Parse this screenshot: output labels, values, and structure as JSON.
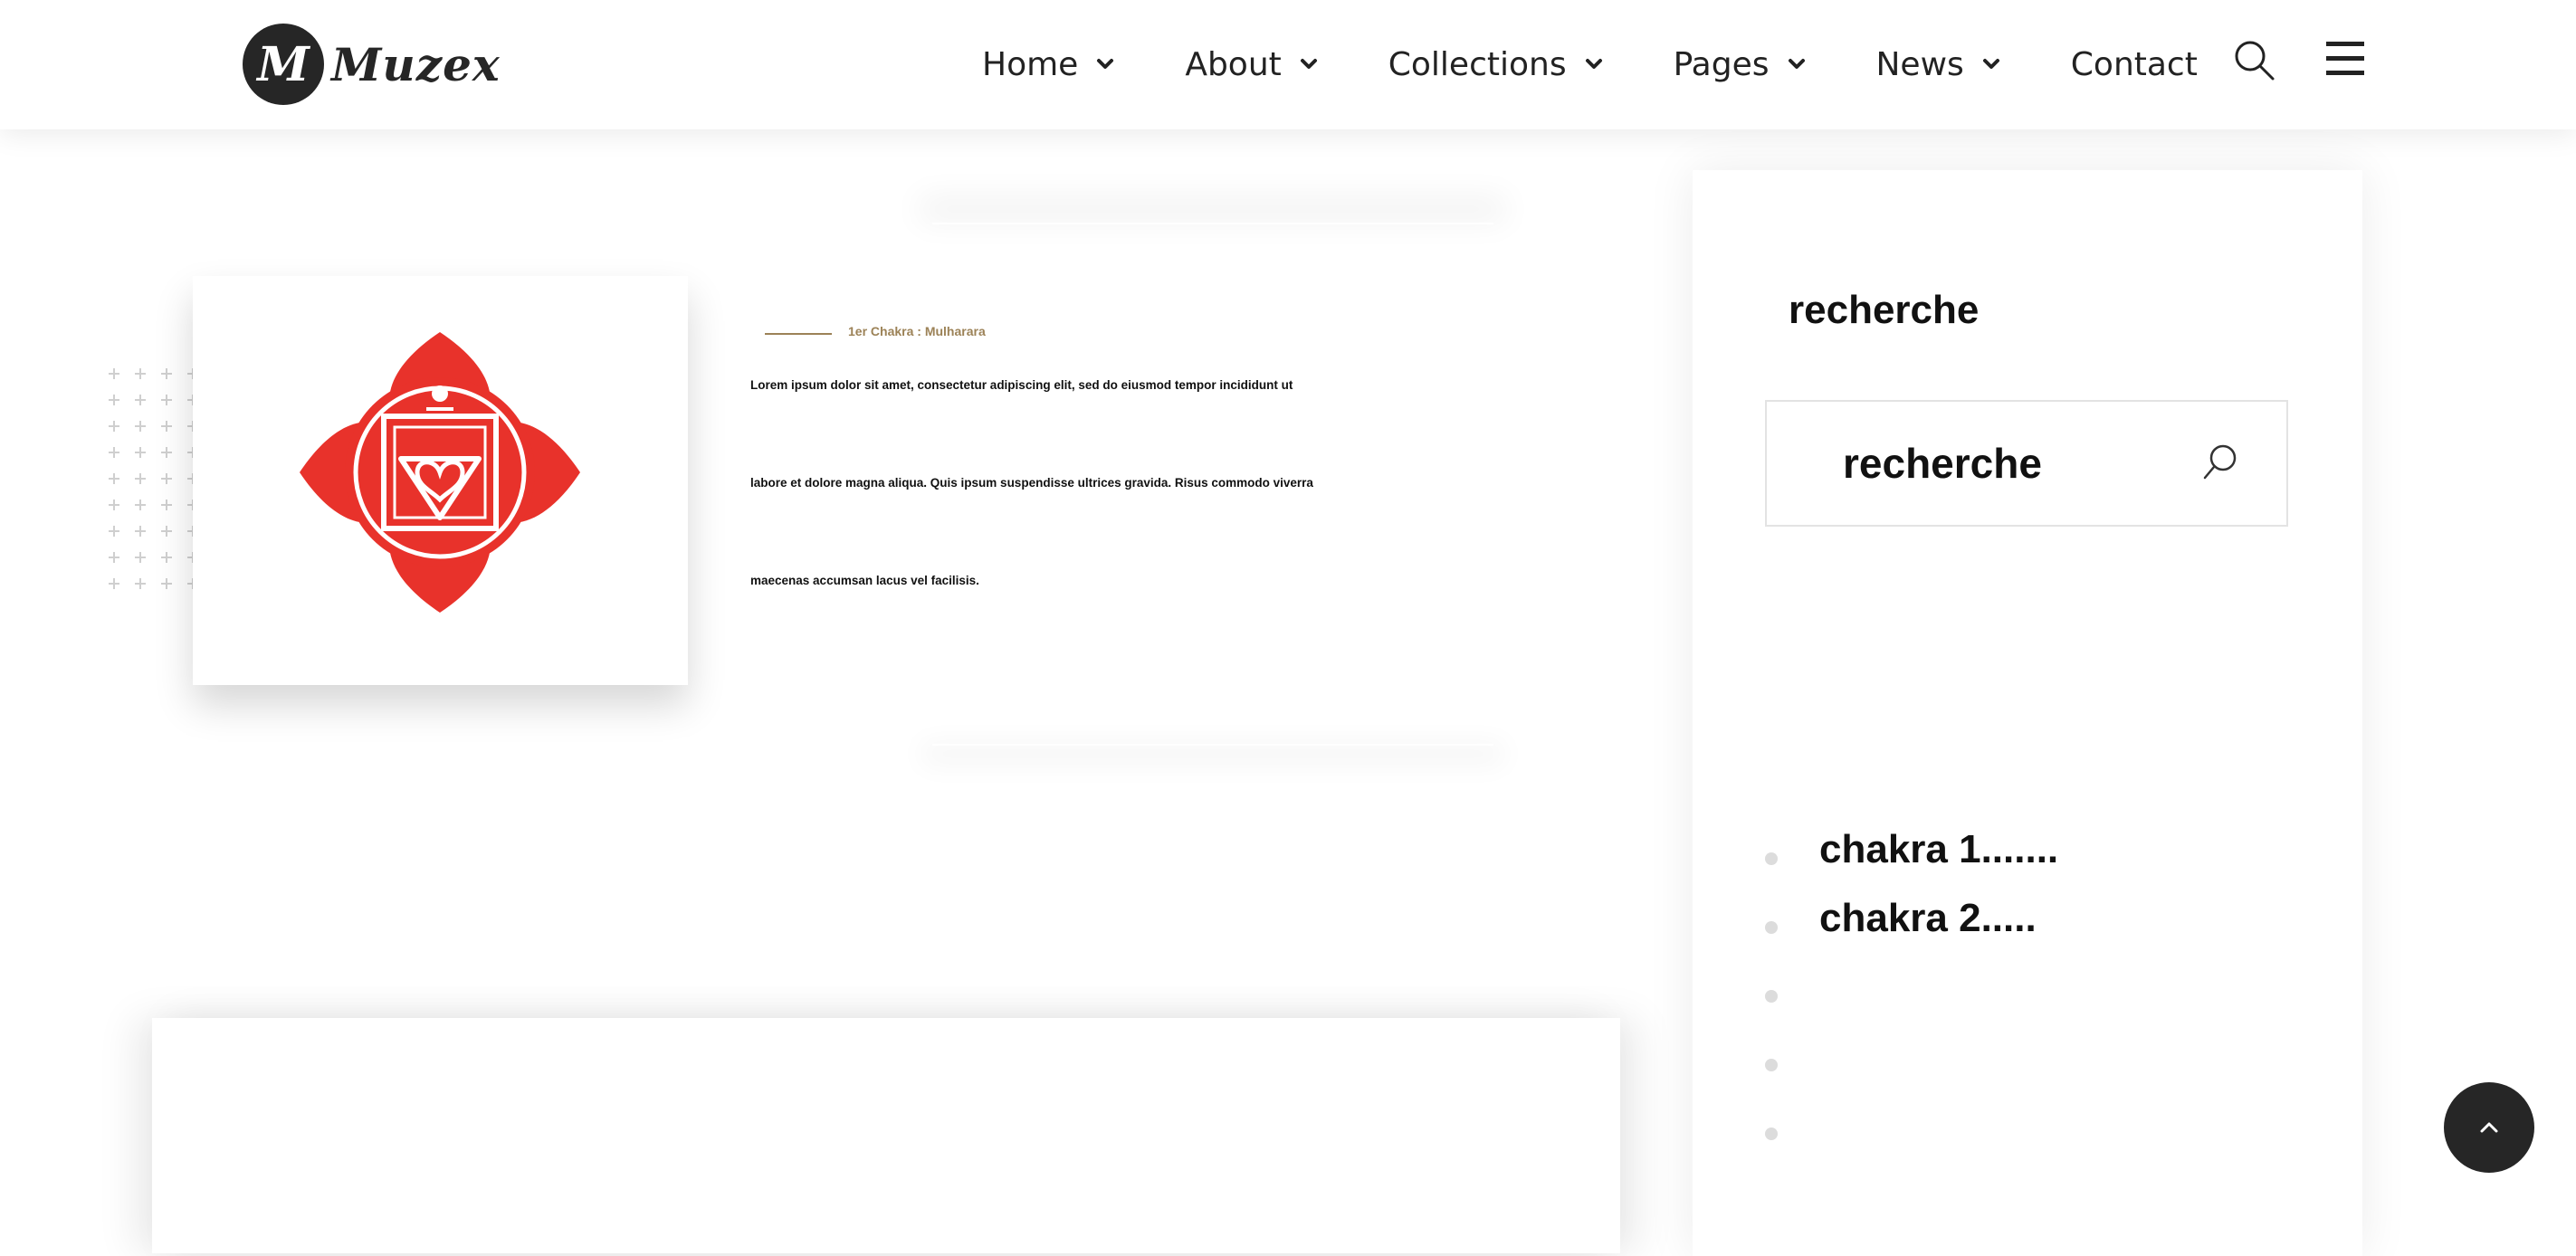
{
  "header": {
    "logo_mark": "M",
    "logo_text": "Muzex",
    "nav": [
      {
        "label": "Home",
        "has_dropdown": true
      },
      {
        "label": "About",
        "has_dropdown": true
      },
      {
        "label": "Collections",
        "has_dropdown": true
      },
      {
        "label": "Pages",
        "has_dropdown": true
      },
      {
        "label": "News",
        "has_dropdown": true
      },
      {
        "label": "Contact",
        "has_dropdown": false
      }
    ],
    "icons": {
      "search": "search-icon",
      "menu": "hamburger-menu-icon"
    }
  },
  "article": {
    "tag": "1er Chakra : Mulharara",
    "paragraphs": [
      "Lorem ipsum dolor sit amet, consectetur adipiscing elit, sed do eiusmod tempor incididunt ut",
      "labore et dolore magna aliqua. Quis ipsum suspendisse ultrices gravida. Risus commodo viverra",
      "maecenas accumsan lacus vel facilisis."
    ],
    "image_icon": "muladhara-chakra-symbol"
  },
  "sidebar": {
    "title": "recherche",
    "search_placeholder": "recherche",
    "links": [
      {
        "label": "chakra 1......."
      },
      {
        "label": "chakra 2....."
      },
      {
        "label": ""
      },
      {
        "label": ""
      },
      {
        "label": ""
      }
    ]
  },
  "colors": {
    "dark": "#262626",
    "accent_gold": "#9c8257",
    "chakra_red": "#e8322b"
  },
  "back_to_top_icon": "chevron-up-icon"
}
